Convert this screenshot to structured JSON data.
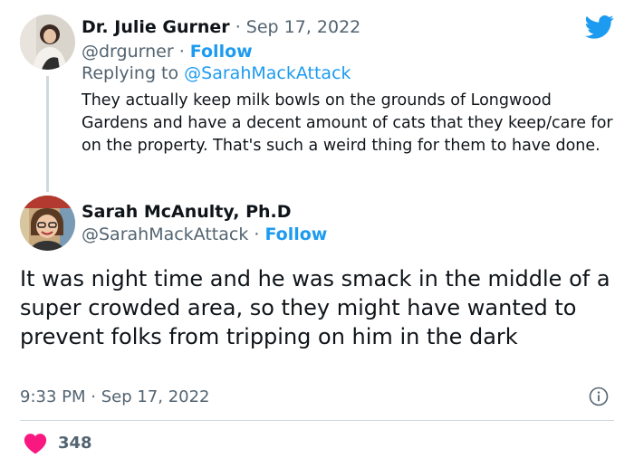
{
  "tweet1": {
    "author_name": "Dr. Julie Gurner",
    "date": "Sep 17, 2022",
    "handle": "@drgurner",
    "follow_label": "Follow",
    "replying_prefix": "Replying to",
    "replying_to": "@SarahMackAttack",
    "text": "They actually keep milk bowls on the grounds of Longwood Gardens and have a decent amount of cats that they keep/care for on the property. That's such a weird thing for them to have done."
  },
  "tweet2": {
    "author_name": "Sarah McAnulty, Ph.D",
    "handle": "@SarahMackAttack",
    "follow_label": "Follow",
    "text": "It was night time and he was smack in the middle of a super crowded area, so they might have wanted to prevent folks from tripping on him in the dark",
    "time": "9:33 PM",
    "date": "Sep 17, 2022",
    "like_count": "348"
  },
  "icons": {
    "brand": "twitter-bird-icon",
    "info": "info-icon",
    "like": "heart-icon"
  },
  "colors": {
    "accent": "#1d9bf0",
    "like": "#f91880",
    "muted": "#536471",
    "text": "#0f1419",
    "border": "#cfd9de"
  }
}
